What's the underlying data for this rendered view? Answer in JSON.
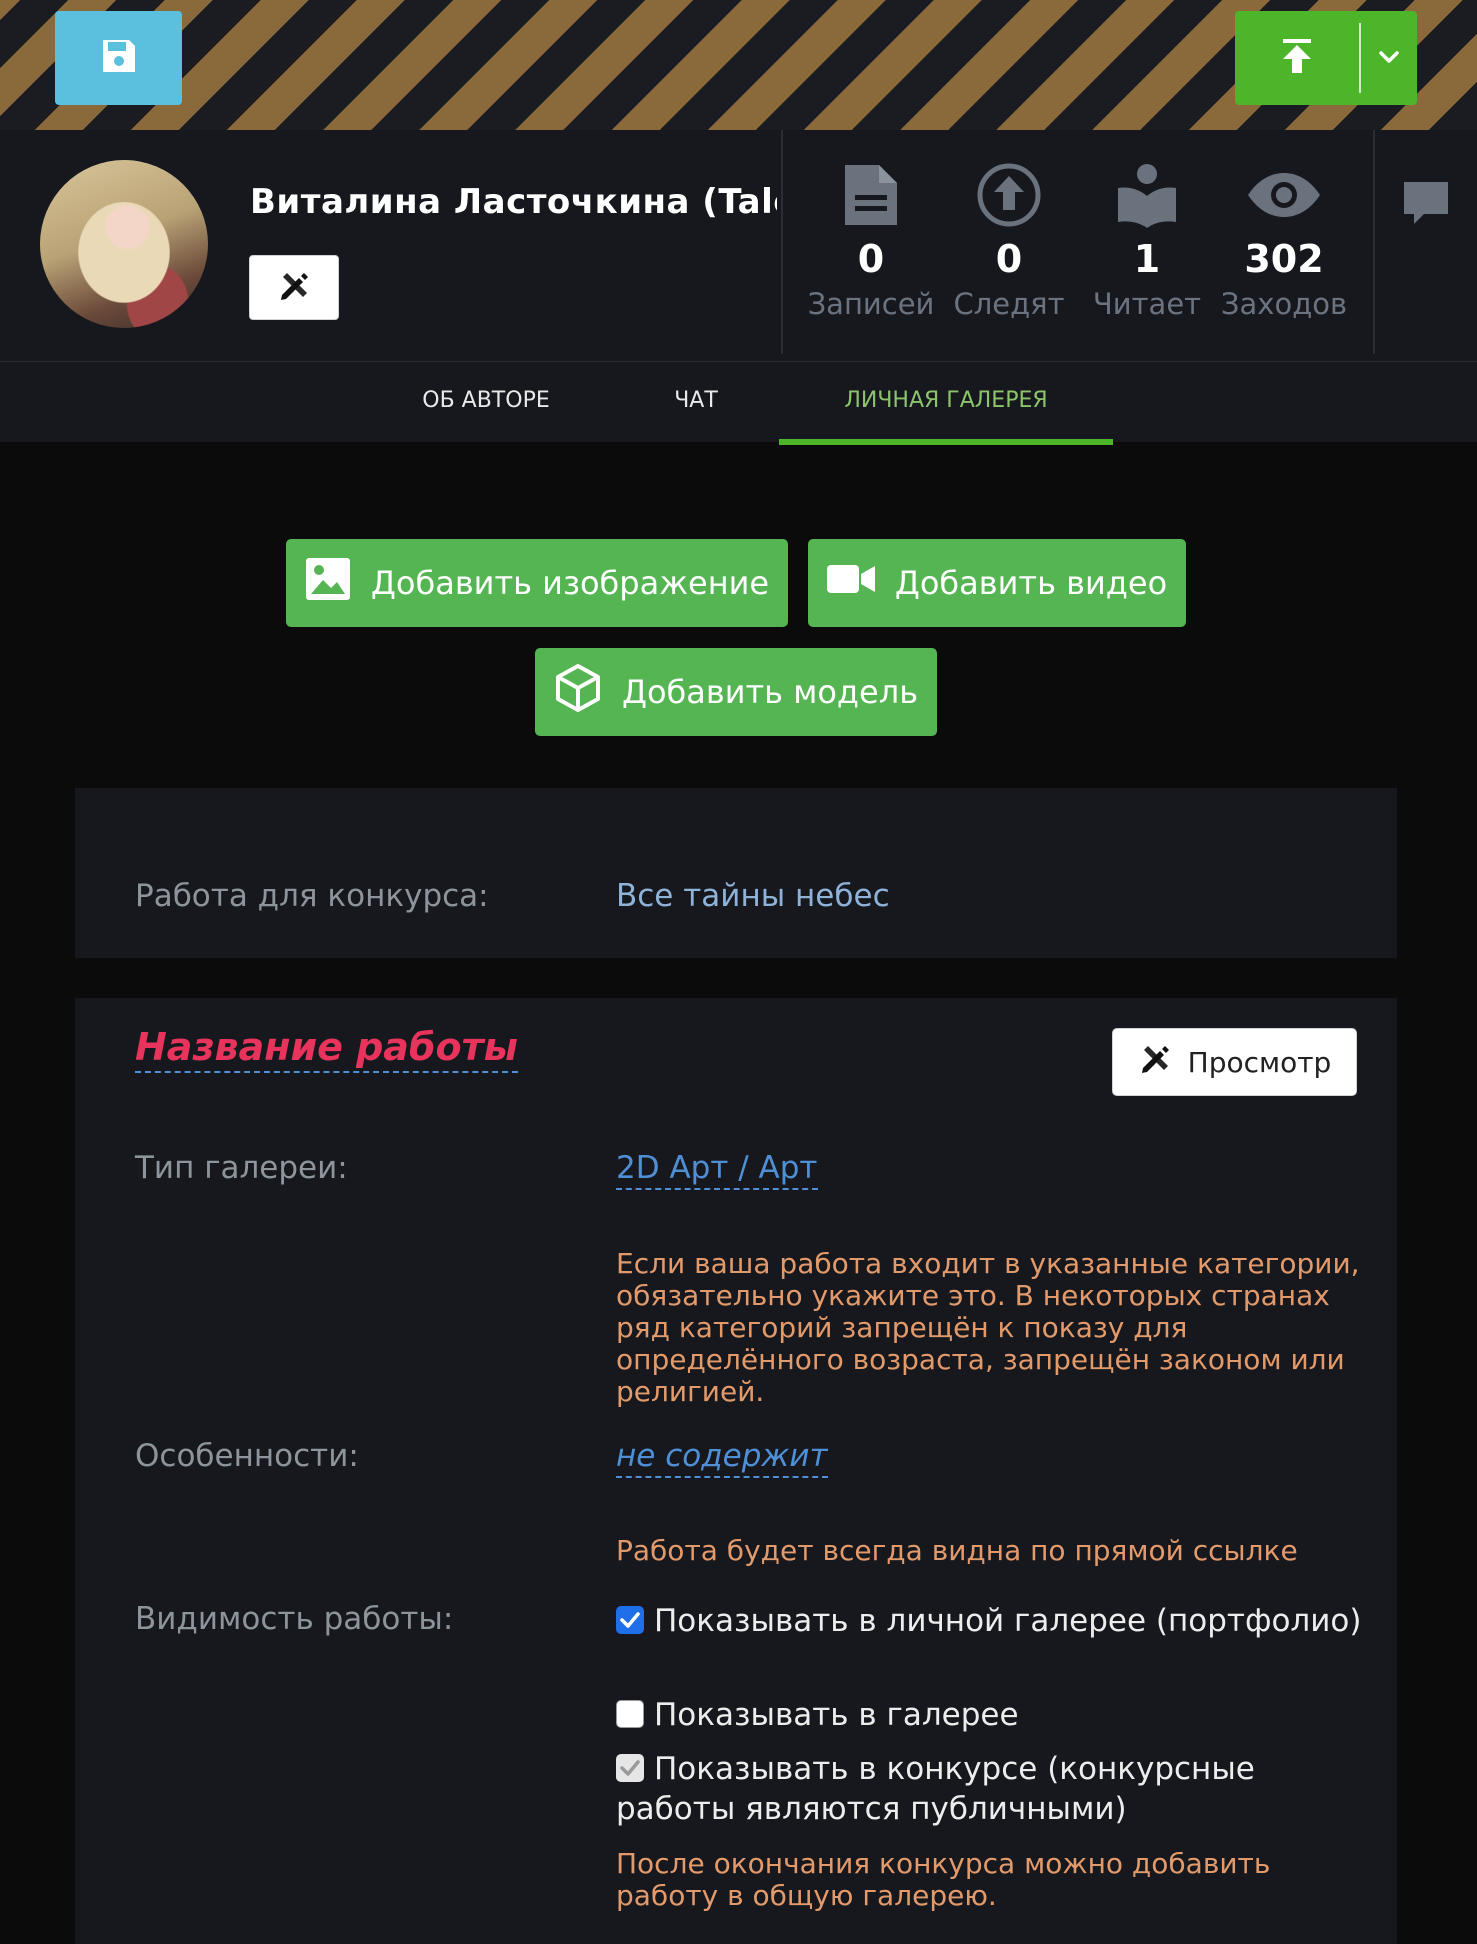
{
  "header": {
    "save_icon": "floppy-disk-icon",
    "publish_icon": "upload-icon",
    "menu_icon": "chevron-down-icon"
  },
  "profile": {
    "name": "Виталина Ласточкина (Talec",
    "stats": [
      {
        "icon": "document-icon",
        "value": "0",
        "label": "Записей"
      },
      {
        "icon": "upload-circle-icon",
        "value": "0",
        "label": "Следят"
      },
      {
        "icon": "reader-icon",
        "value": "1",
        "label": "Читает"
      },
      {
        "icon": "eye-icon",
        "value": "302",
        "label": "Заходов"
      }
    ]
  },
  "tabs": [
    {
      "label": "ОБ АВТОРЕ",
      "active": false
    },
    {
      "label": "ЧАТ",
      "active": false
    },
    {
      "label": "ЛИЧНАЯ ГАЛЕРЕЯ",
      "active": true
    }
  ],
  "actions": {
    "add_image": "Добавить изображение",
    "add_video": "Добавить видео",
    "add_model": "Добавить модель"
  },
  "contest": {
    "label": "Работа для конкурса:",
    "value": "Все тайны небес"
  },
  "form": {
    "title": "Название работы",
    "preview": "Просмотр",
    "gallery_type_label": "Тип галереи:",
    "gallery_type_value": "2D Арт / Арт",
    "features_warning": "Если ваша работа входит в указанные категории, обязательно укажите это. В некоторых странах ряд категорий запрещён к показу для определённого возраста, запрещён законом или религией.",
    "features_label": "Особенности:",
    "features_value": "не содержит",
    "visibility_note": "Работа будет всегда видна по прямой ссылке",
    "visibility_label": "Видимость работы:",
    "visibility_options": [
      {
        "label": "Показывать в личной галерее (портфолио)",
        "checked": true
      },
      {
        "label": "Показывать в галерее",
        "checked": false
      },
      {
        "label": "Показывать в конкурсе (конкурсные работы являются публичными)",
        "checked": true,
        "disabled": true
      }
    ],
    "contest_note": "После окончания конкурса можно добавить работу в общую галерею."
  },
  "colors": {
    "accent_green": "#4cb52a",
    "save_blue": "#5bc0de",
    "title_red": "#e8345c",
    "warning_orange": "#e39a6b",
    "link_blue": "#4f8fd6"
  }
}
